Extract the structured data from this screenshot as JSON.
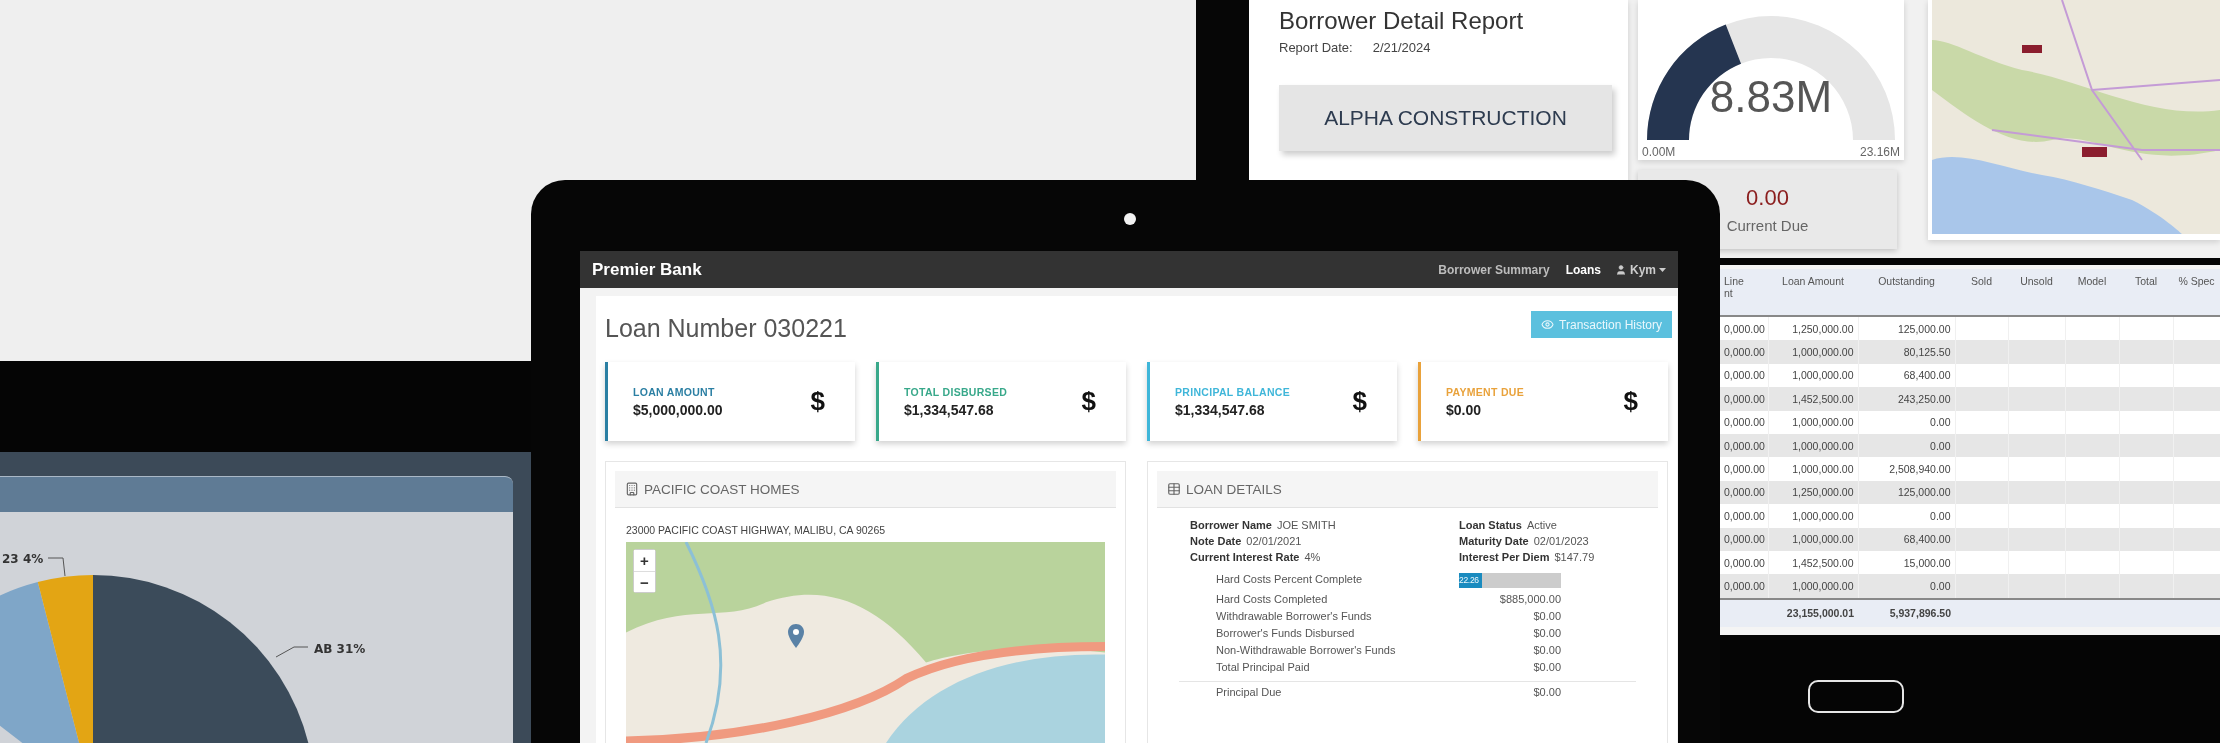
{
  "report_screen": {
    "title": "Borrower Detail Report",
    "report_date_label": "Report Date:",
    "report_date": "2/21/2024",
    "entity_button": "ALPHA CONSTRUCTION",
    "gauge": {
      "value": "8.83M",
      "min": "0.00M",
      "max": "23.16M",
      "level": 0.381
    },
    "current_due": {
      "value": "0.00",
      "label": "Current Due"
    }
  },
  "pie_panel": {
    "slice_labels": [
      "23 4%",
      "AB 31%"
    ]
  },
  "loan_app": {
    "brand": "Premier Bank",
    "nav": [
      {
        "label": "Borrower Summary",
        "selected": false
      },
      {
        "label": "Loans",
        "selected": true
      }
    ],
    "user": {
      "name": "Kym"
    },
    "page_title": "Loan Number 030221",
    "history_button": "Transaction History",
    "stat_cards": [
      {
        "label": "LOAN AMOUNT",
        "value": "$5,000,000.00",
        "symbol": "$",
        "color": "#2b7fa3"
      },
      {
        "label": "TOTAL DISBURSED",
        "value": "$1,334,547.68",
        "symbol": "$",
        "color": "#38a88a"
      },
      {
        "label": "PRINCIPAL BALANCE",
        "value": "$1,334,547.68",
        "symbol": "$",
        "color": "#3fb6d9"
      },
      {
        "label": "PAYMENT DUE",
        "value": "$0.00",
        "symbol": "$",
        "color": "#e9a23b"
      }
    ],
    "property_panel": {
      "title": "PACIFIC COAST HOMES",
      "address": "23000 PACIFIC COAST HIGHWAY, MALIBU, CA 90265",
      "map_controls": [
        "+",
        "−"
      ]
    },
    "details_panel": {
      "title": "LOAN DETAILS",
      "summary": [
        {
          "label": "Borrower Name",
          "value": "JOE SMITH"
        },
        {
          "label": "Loan Status",
          "value": "Active"
        },
        {
          "label": "Note Date",
          "value": "02/01/2021"
        },
        {
          "label": "Maturity Date",
          "value": "02/01/2023"
        },
        {
          "label": "Current Interest Rate",
          "value": "4%"
        },
        {
          "label": "Interest Per Diem",
          "value": "$147.79"
        }
      ],
      "breakdown": [
        {
          "kind": "progress",
          "label": "Hard Costs Percent Complete",
          "value": "22.26",
          "level": 0.2226
        },
        {
          "kind": "amount",
          "label": "Hard Costs Completed",
          "value": "$885,000.00"
        },
        {
          "kind": "amount",
          "label": "Withdrawable Borrower's Funds",
          "value": "$0.00"
        },
        {
          "kind": "amount",
          "label": "Borrower's Funds Disbursed",
          "value": "$0.00"
        },
        {
          "kind": "amount",
          "label": "Non-Withdrawable Borrower's Funds",
          "value": "$0.00"
        },
        {
          "kind": "amount",
          "label": "Total Principal Paid",
          "value": "$0.00"
        }
      ],
      "after_rule": [
        {
          "label": "Principal Due",
          "value": "$0.00"
        }
      ]
    }
  },
  "loans_table": {
    "columns": [
      "Line\nnt",
      "Loan Amount",
      "Outstanding",
      "Sold",
      "Unsold",
      "Model",
      "Total",
      "% Spec"
    ],
    "rows": [
      [
        "0,000.00",
        "1,250,000.00",
        "125,000.00"
      ],
      [
        "0,000.00",
        "1,000,000.00",
        "80,125.50"
      ],
      [
        "0,000.00",
        "1,000,000.00",
        "68,400.00"
      ],
      [
        "0,000.00",
        "1,452,500.00",
        "243,250.00"
      ],
      [
        "0,000.00",
        "1,000,000.00",
        "0.00"
      ],
      [
        "0,000.00",
        "1,000,000.00",
        "0.00"
      ],
      [
        "0,000.00",
        "1,000,000.00",
        "2,508,940.00"
      ],
      [
        "0,000.00",
        "1,250,000.00",
        "125,000.00"
      ],
      [
        "0,000.00",
        "1,000,000.00",
        "0.00"
      ],
      [
        "0,000.00",
        "1,000,000.00",
        "68,400.00"
      ],
      [
        "0,000.00",
        "1,452,500.00",
        "15,000.00"
      ],
      [
        "0,000.00",
        "1,000,000.00",
        "0.00"
      ]
    ],
    "totals": [
      "23,155,000.01",
      "5,937,896.50"
    ]
  }
}
